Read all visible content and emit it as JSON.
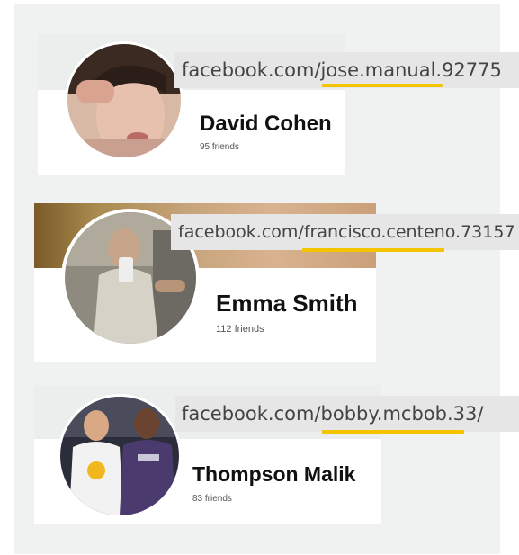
{
  "profiles": [
    {
      "name": "David Cohen",
      "friends": "95 friends",
      "url_prefix": "facebook.com/",
      "url_handle": "jose.manual.92775"
    },
    {
      "name": "Emma Smith",
      "friends": "112 friends",
      "url_prefix": "facebook.com/",
      "url_handle": "francisco.centeno.73157"
    },
    {
      "name": "Thompson Malik",
      "friends": "83 friends",
      "url_prefix": "facebook.com/",
      "url_handle": "bobby.mcbob.33/"
    }
  ],
  "colors": {
    "highlight_underline": "#f5c400",
    "url_box": "#e6e6e6",
    "panel": "#f0f2f2"
  }
}
